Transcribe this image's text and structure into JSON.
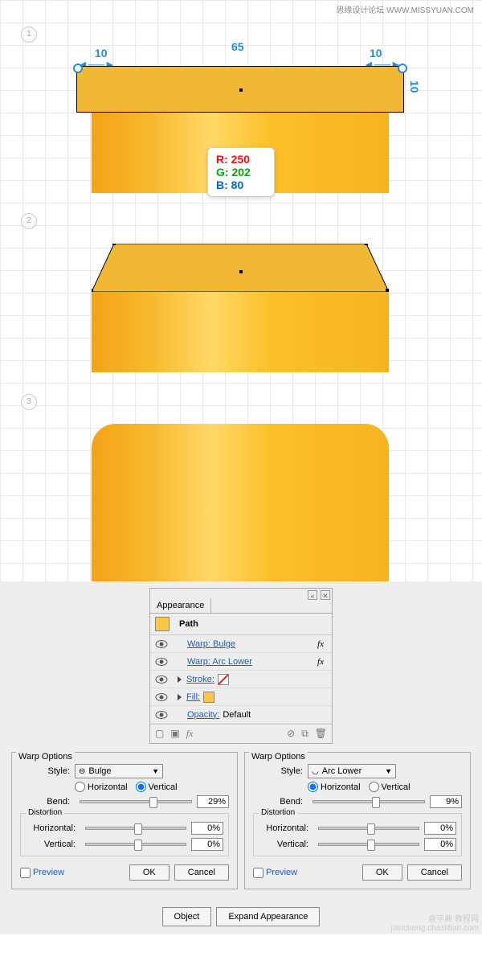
{
  "watermark": {
    "top_cn": "思缘设计论坛",
    "top_url": "WWW.MISSYUAN.COM",
    "bot1": "查字典",
    "bot2": "教程网",
    "bot3": "jiaocheng.chazidian.com"
  },
  "steps": {
    "s1": "1",
    "s2": "2",
    "s3": "3"
  },
  "dims": {
    "left": "10",
    "mid": "65",
    "right": "10",
    "side": "10"
  },
  "rgb": {
    "r": "R: 250",
    "g": "G: 202",
    "b": "B: 80"
  },
  "appearance": {
    "tab": "Appearance",
    "item": "Path",
    "rows": [
      {
        "label": "Warp: Bulge",
        "fx": "fx"
      },
      {
        "label": "Warp: Arc Lower",
        "fx": "fx"
      },
      {
        "label": "Stroke:"
      },
      {
        "label": "Fill:"
      },
      {
        "label": "Opacity:",
        "val": "Default"
      }
    ],
    "foot_fx": "fx"
  },
  "warp1": {
    "title": "Warp Options",
    "style_lbl": "Style:",
    "style_val": "Bulge",
    "horiz": "Horizontal",
    "vert": "Vertical",
    "bend_lbl": "Bend:",
    "bend_val": "29%",
    "distortion": "Distortion",
    "hlbl": "Horizontal:",
    "hval": "0%",
    "vlbl": "Vertical:",
    "vval": "0%",
    "preview": "Preview",
    "ok": "OK",
    "cancel": "Cancel"
  },
  "warp2": {
    "title": "Warp Options",
    "style_lbl": "Style:",
    "style_val": "Arc Lower",
    "horiz": "Horizontal",
    "vert": "Vertical",
    "bend_lbl": "Bend:",
    "bend_val": "9%",
    "distortion": "Distortion",
    "hlbl": "Horizontal:",
    "hval": "0%",
    "vlbl": "Vertical:",
    "vval": "0%",
    "preview": "Preview",
    "ok": "OK",
    "cancel": "Cancel"
  },
  "bottom": {
    "object": "Object",
    "expand": "Expand Appearance"
  }
}
